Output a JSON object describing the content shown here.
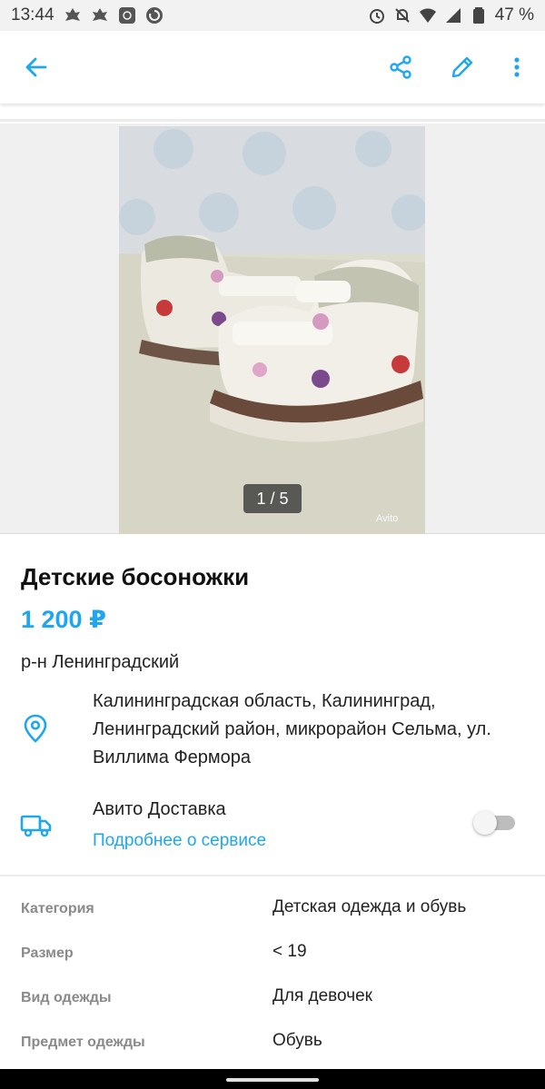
{
  "status_bar": {
    "time": "13:44",
    "battery": "47 %"
  },
  "app_bar": {
    "icons": [
      "arrow-left-icon",
      "share-icon",
      "pencil-icon",
      "more-vert-icon"
    ],
    "accent_color": "#1ea7f0"
  },
  "gallery": {
    "counter": "1 / 5",
    "watermark": "Avito"
  },
  "listing": {
    "title": "Детские босоножки",
    "price": "1 200 ₽",
    "district": "р-н Ленинградский",
    "address": "Калининградская область, Калининград, Ленинградский район, микрорайон Сельма, ул. Виллима Фермора"
  },
  "delivery": {
    "title": "Авито Доставка",
    "link": "Подробнее о сервисе",
    "enabled": false
  },
  "params": [
    {
      "label": "Категория",
      "value": "Детская одежда и обувь"
    },
    {
      "label": "Размер",
      "value": "< 19"
    },
    {
      "label": "Вид одежды",
      "value": "Для девочек"
    },
    {
      "label": "Предмет одежды",
      "value": "Обувь"
    }
  ]
}
